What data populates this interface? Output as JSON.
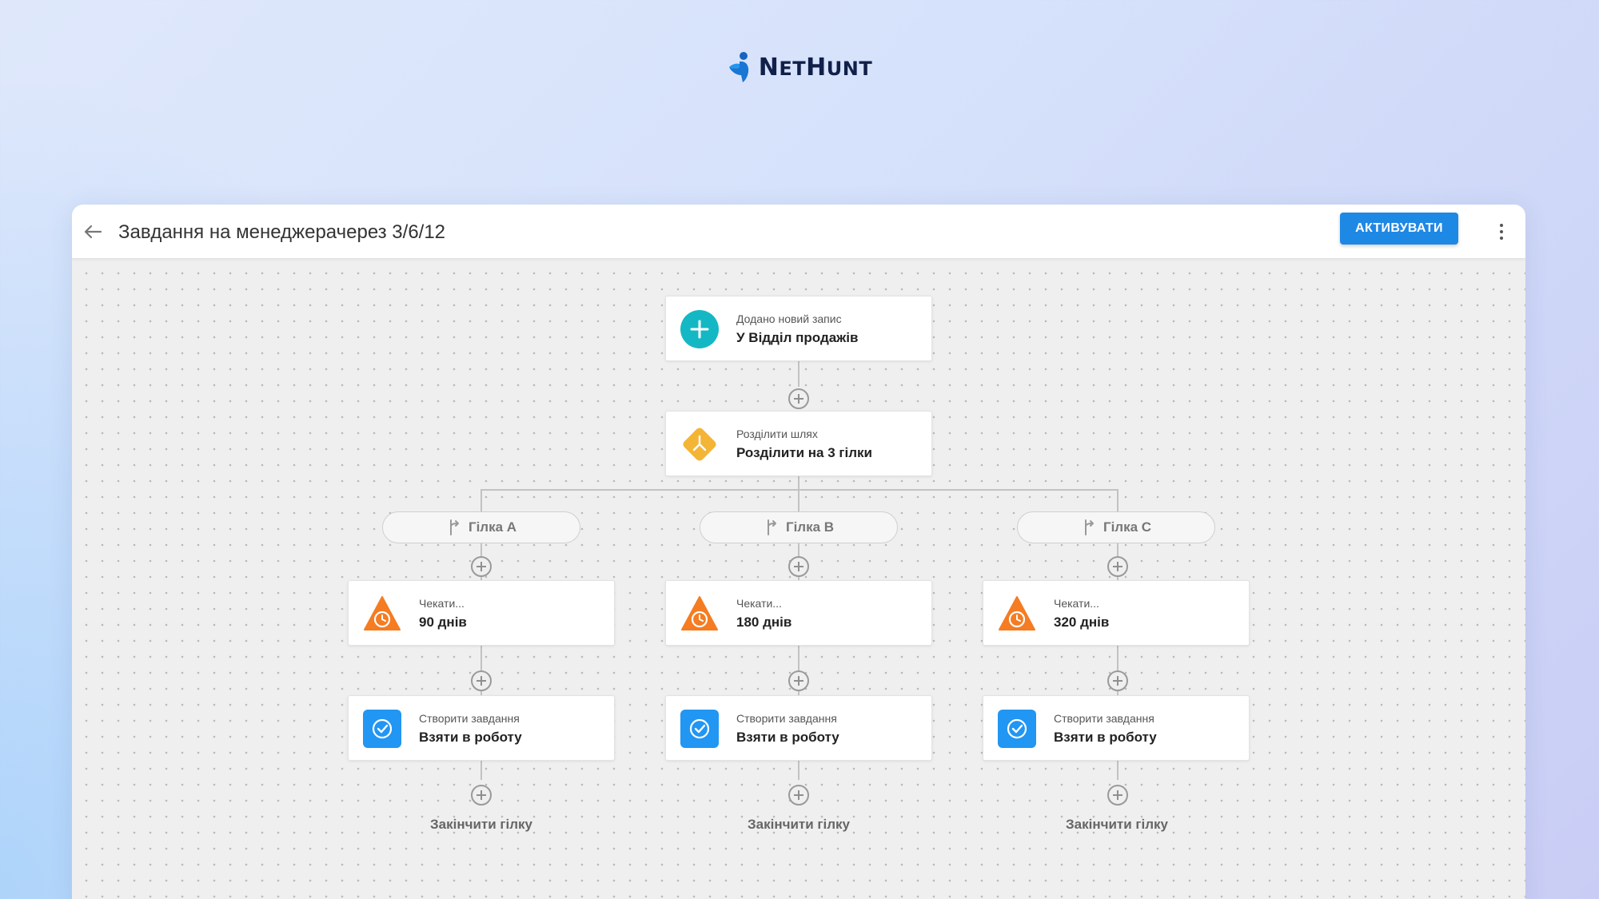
{
  "logo": {
    "name_part1": "N",
    "name_part1_small": "ET",
    "name_part2": "H",
    "name_part2_small": "UNT",
    "full": "NetHunt"
  },
  "header": {
    "title": "Завдання на менеджерачерез 3/6/12",
    "activate_label": "АКТИВУВАТИ"
  },
  "colors": {
    "accent": "#1e88e5",
    "trigger": "#14b8c4",
    "split": "#f4b537",
    "wait": "#f57c22",
    "task": "#2196f3"
  },
  "flow": {
    "trigger": {
      "sub": "Додано новий запис",
      "main": "У Відділ продажів",
      "icon": "plus-circle-icon"
    },
    "split": {
      "sub": "Розділити шлях",
      "main": "Розділити на 3 гілки",
      "icon": "split-diamond-icon"
    },
    "branches": [
      {
        "label": "Гілка A",
        "wait_sub": "Чекати...",
        "wait_main": "90 днів",
        "task_sub": "Створити завдання",
        "task_main": "Взяти в роботу",
        "end": "Закінчити гілку"
      },
      {
        "label": "Гілка B",
        "wait_sub": "Чекати...",
        "wait_main": "180 днів",
        "task_sub": "Створити завдання",
        "task_main": "Взяти в роботу",
        "end": "Закінчити гілку"
      },
      {
        "label": "Гілка C",
        "wait_sub": "Чекати...",
        "wait_main": "320 днів",
        "task_sub": "Створити завдання",
        "task_main": "Взяти в роботу",
        "end": "Закінчити гілку"
      }
    ]
  }
}
